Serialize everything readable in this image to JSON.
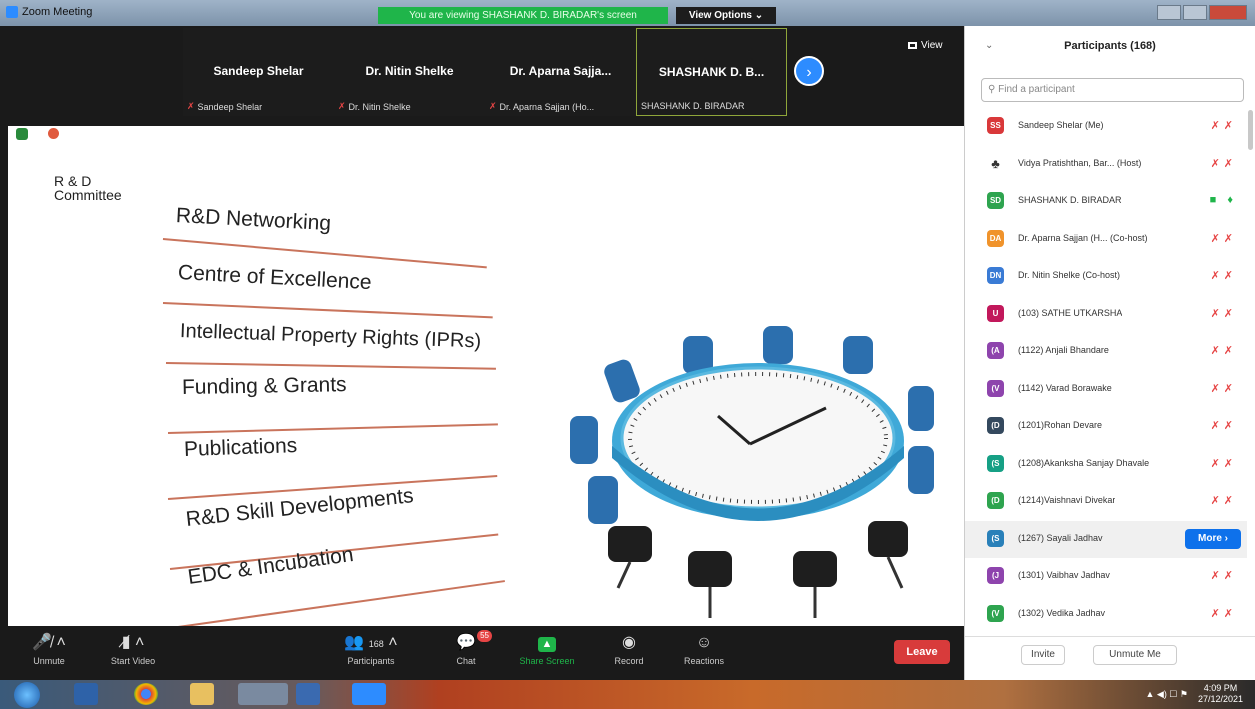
{
  "window": {
    "title": "Zoom Meeting",
    "viewing_banner": "You are viewing SHASHANK D. BIRADAR's screen",
    "view_options": "View Options ⌄"
  },
  "thumbnails": [
    {
      "name": "Sandeep Shelar",
      "label": "Sandeep Shelar",
      "muted": true
    },
    {
      "name": "Dr. Nitin Shelke",
      "label": "Dr. Nitin Shelke",
      "muted": true
    },
    {
      "name": "Dr. Aparna Sajja...",
      "label": "Dr. Aparna Sajjan (Ho...",
      "muted": true
    },
    {
      "name": "SHASHANK D. B...",
      "label": "SHASHANK D. BIRADAR",
      "muted": false
    }
  ],
  "view_button": "View",
  "slide": {
    "committee_line1": "R & D",
    "committee_line2": "Committee",
    "items": [
      "R&D Networking",
      "Centre of Excellence",
      "Intellectual Property Rights (IPRs)",
      "Funding & Grants",
      "Publications",
      "R&D Skill Developments",
      "EDC & Incubation"
    ]
  },
  "toolbar": {
    "unmute": "Unmute",
    "start_video": "Start Video",
    "participants": "Participants",
    "participants_count": "168",
    "chat": "Chat",
    "chat_badge": "55",
    "share_screen": "Share Screen",
    "record": "Record",
    "reactions": "Reactions",
    "leave": "Leave"
  },
  "panel": {
    "title": "Participants (168)",
    "search_placeholder": "Find a participant",
    "participants": [
      {
        "initials": "SS",
        "name": "Sandeep Shelar (Me)",
        "color": "#d9383a",
        "muted": true
      },
      {
        "initials": "",
        "name": "Vidya Pratishthan, Bar... (Host)",
        "color": "#ffffff",
        "muted": true
      },
      {
        "initials": "SD",
        "name": "SHASHANK D. BIRADAR",
        "color": "#2ea44f",
        "muted": false
      },
      {
        "initials": "DA",
        "name": "Dr. Aparna Sajjan (H...  (Co-host)",
        "color": "#f0932b",
        "muted": true
      },
      {
        "initials": "DN",
        "name": "Dr. Nitin Shelke (Co-host)",
        "color": "#3a7bd5",
        "muted": true
      },
      {
        "initials": "U",
        "name": "(103) SATHE UTKARSHA",
        "color": "#c2185b",
        "muted": true
      },
      {
        "initials": "(A",
        "name": "(1122) Anjali Bhandare",
        "color": "#8e44ad",
        "muted": true
      },
      {
        "initials": "(V",
        "name": "(1142) Varad Borawake",
        "color": "#8e44ad",
        "muted": true
      },
      {
        "initials": "(D",
        "name": "(1201)Rohan Devare",
        "color": "#34495e",
        "muted": true
      },
      {
        "initials": "(S",
        "name": "(1208)Akanksha Sanjay Dhavale",
        "color": "#16a085",
        "muted": true
      },
      {
        "initials": "(D",
        "name": "(1214)Vaishnavi Divekar",
        "color": "#2ea44f",
        "muted": true
      },
      {
        "initials": "(S",
        "name": "(1267) Sayali Jadhav",
        "color": "#2980b9",
        "muted": false
      },
      {
        "initials": "(J",
        "name": "(1301) Vaibhav Jadhav",
        "color": "#8e44ad",
        "muted": true
      },
      {
        "initials": "(V",
        "name": "(1302) Vedika Jadhav",
        "color": "#2ea44f",
        "muted": true
      }
    ],
    "more_button": "More ›",
    "invite": "Invite",
    "unmute_me": "Unmute Me"
  },
  "taskbar": {
    "time": "4:09 PM",
    "date": "27/12/2021"
  }
}
